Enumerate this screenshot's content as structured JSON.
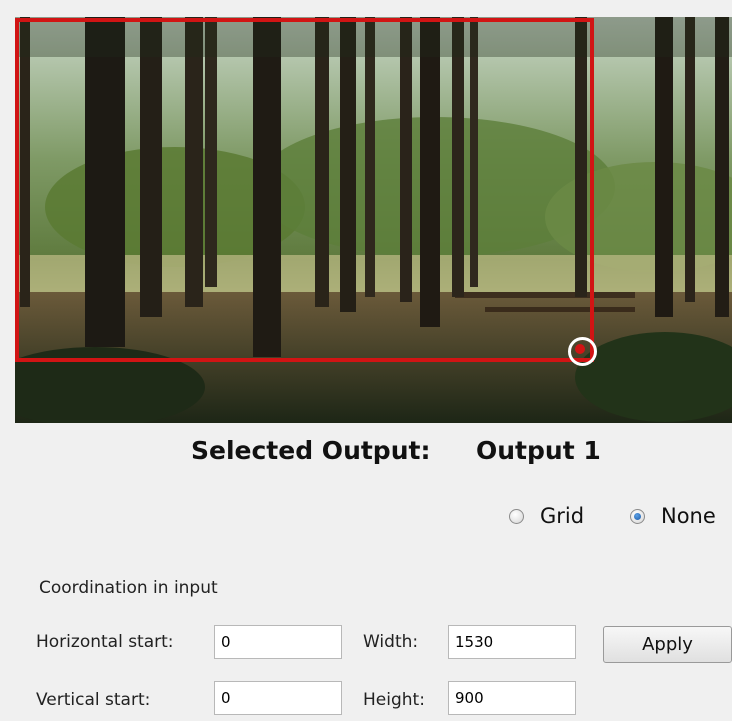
{
  "preview": {
    "image_description_icon": "forest-photo"
  },
  "selected_output": {
    "label": "Selected Output:",
    "value": "Output 1"
  },
  "overlay_mode": {
    "options": [
      {
        "label": "Grid",
        "checked": false
      },
      {
        "label": "None",
        "checked": true
      }
    ]
  },
  "coordination": {
    "section_label": "Coordination in input",
    "horizontal_start_label": "Horizontal start:",
    "horizontal_start_value": "0",
    "vertical_start_label": "Vertical start:",
    "vertical_start_value": "0",
    "width_label": "Width:",
    "width_value": "1530",
    "height_label": "Height:",
    "height_value": "900"
  },
  "actions": {
    "apply_label": "Apply"
  },
  "colors": {
    "selection_border": "#d11414",
    "background": "#f0f0f0"
  }
}
